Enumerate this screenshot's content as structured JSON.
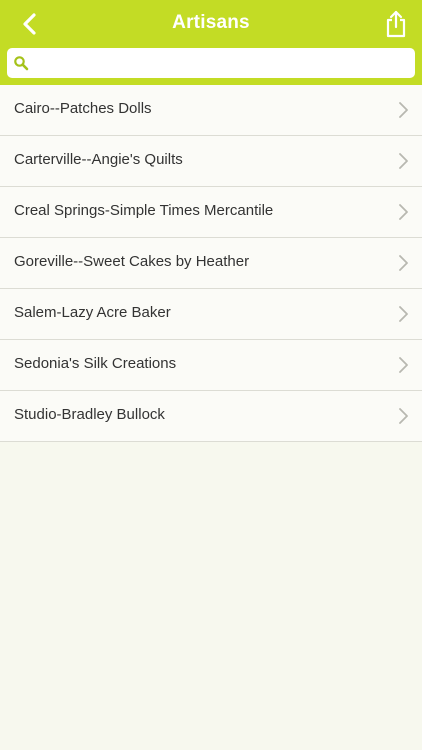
{
  "header": {
    "title": "Artisans",
    "back_icon": "chevron-left-icon",
    "share_icon": "share-icon",
    "bar_color": "#c3dc25"
  },
  "search": {
    "placeholder": "",
    "value": "",
    "icon": "search-icon"
  },
  "list": {
    "items": [
      {
        "label": "Cairo--Patches Dolls"
      },
      {
        "label": "Carterville--Angie's Quilts"
      },
      {
        "label": "Creal Springs-Simple Times Mercantile"
      },
      {
        "label": "Goreville--Sweet Cakes by Heather"
      },
      {
        "label": "Salem-Lazy Acre Baker"
      },
      {
        "label": "Sedonia's Silk Creations"
      },
      {
        "label": "Studio-Bradley Bullock"
      }
    ]
  }
}
